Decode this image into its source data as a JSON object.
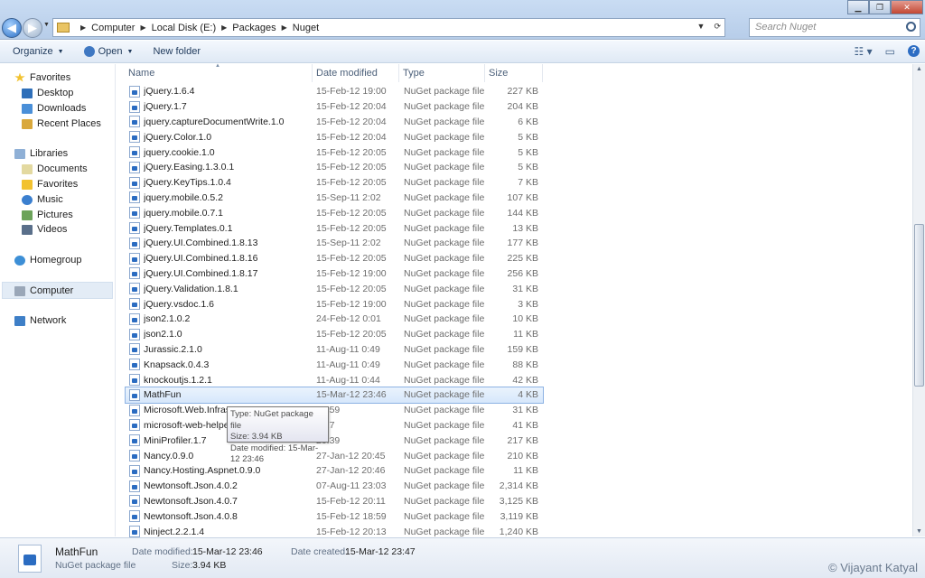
{
  "address": {
    "breadcrumbs": [
      "Computer",
      "Local Disk (E:)",
      "Packages",
      "Nuget"
    ],
    "search_placeholder": "Search Nuget"
  },
  "toolbar": {
    "organize": "Organize",
    "open": "Open",
    "new_folder": "New folder"
  },
  "nav": {
    "favorites": "Favorites",
    "desktop": "Desktop",
    "downloads": "Downloads",
    "recent_places": "Recent Places",
    "libraries": "Libraries",
    "documents": "Documents",
    "lib_favorites": "Favorites",
    "music": "Music",
    "pictures": "Pictures",
    "videos": "Videos",
    "homegroup": "Homegroup",
    "computer": "Computer",
    "network": "Network"
  },
  "columns": {
    "name": "Name",
    "date": "Date modified",
    "type": "Type",
    "size": "Size"
  },
  "files": [
    {
      "name": "jQuery.1.6.4",
      "date": "15-Feb-12 19:00",
      "type": "NuGet package file",
      "size": "227 KB"
    },
    {
      "name": "jQuery.1.7",
      "date": "15-Feb-12 20:04",
      "type": "NuGet package file",
      "size": "204 KB"
    },
    {
      "name": "jquery.captureDocumentWrite.1.0",
      "date": "15-Feb-12 20:04",
      "type": "NuGet package file",
      "size": "6 KB"
    },
    {
      "name": "jQuery.Color.1.0",
      "date": "15-Feb-12 20:04",
      "type": "NuGet package file",
      "size": "5 KB"
    },
    {
      "name": "jquery.cookie.1.0",
      "date": "15-Feb-12 20:05",
      "type": "NuGet package file",
      "size": "5 KB"
    },
    {
      "name": "jQuery.Easing.1.3.0.1",
      "date": "15-Feb-12 20:05",
      "type": "NuGet package file",
      "size": "5 KB"
    },
    {
      "name": "jQuery.KeyTips.1.0.4",
      "date": "15-Feb-12 20:05",
      "type": "NuGet package file",
      "size": "7 KB"
    },
    {
      "name": "jquery.mobile.0.5.2",
      "date": "15-Sep-11 2:02",
      "type": "NuGet package file",
      "size": "107 KB"
    },
    {
      "name": "jquery.mobile.0.7.1",
      "date": "15-Feb-12 20:05",
      "type": "NuGet package file",
      "size": "144 KB"
    },
    {
      "name": "jQuery.Templates.0.1",
      "date": "15-Feb-12 20:05",
      "type": "NuGet package file",
      "size": "13 KB"
    },
    {
      "name": "jQuery.UI.Combined.1.8.13",
      "date": "15-Sep-11 2:02",
      "type": "NuGet package file",
      "size": "177 KB"
    },
    {
      "name": "jQuery.UI.Combined.1.8.16",
      "date": "15-Feb-12 20:05",
      "type": "NuGet package file",
      "size": "225 KB"
    },
    {
      "name": "jQuery.UI.Combined.1.8.17",
      "date": "15-Feb-12 19:00",
      "type": "NuGet package file",
      "size": "256 KB"
    },
    {
      "name": "jQuery.Validation.1.8.1",
      "date": "15-Feb-12 20:05",
      "type": "NuGet package file",
      "size": "31 KB"
    },
    {
      "name": "jQuery.vsdoc.1.6",
      "date": "15-Feb-12 19:00",
      "type": "NuGet package file",
      "size": "3 KB"
    },
    {
      "name": "json2.1.0.2",
      "date": "24-Feb-12 0:01",
      "type": "NuGet package file",
      "size": "10 KB"
    },
    {
      "name": "json2.1.0",
      "date": "15-Feb-12 20:05",
      "type": "NuGet package file",
      "size": "11 KB"
    },
    {
      "name": "Jurassic.2.1.0",
      "date": "11-Aug-11 0:49",
      "type": "NuGet package file",
      "size": "159 KB"
    },
    {
      "name": "Knapsack.0.4.3",
      "date": "11-Aug-11 0:49",
      "type": "NuGet package file",
      "size": "88 KB"
    },
    {
      "name": "knockoutjs.1.2.1",
      "date": "11-Aug-11 0:44",
      "type": "NuGet package file",
      "size": "42 KB"
    },
    {
      "name": "MathFun",
      "date": "15-Mar-12 23:46",
      "type": "NuGet package file",
      "size": "4 KB"
    },
    {
      "name": "Microsoft.Web.Infrast",
      "date": "18:59",
      "type": "NuGet package file",
      "size": "31 KB"
    },
    {
      "name": "microsoft-web-helper",
      "date": "0:27",
      "type": "NuGet package file",
      "size": "41 KB"
    },
    {
      "name": "MiniProfiler.1.7",
      "date": "20:39",
      "type": "NuGet package file",
      "size": "217 KB"
    },
    {
      "name": "Nancy.0.9.0",
      "date": "27-Jan-12 20:45",
      "type": "NuGet package file",
      "size": "210 KB"
    },
    {
      "name": "Nancy.Hosting.Aspnet.0.9.0",
      "date": "27-Jan-12 20:46",
      "type": "NuGet package file",
      "size": "11 KB"
    },
    {
      "name": "Newtonsoft.Json.4.0.2",
      "date": "07-Aug-11 23:03",
      "type": "NuGet package file",
      "size": "2,314 KB"
    },
    {
      "name": "Newtonsoft.Json.4.0.7",
      "date": "15-Feb-12 20:11",
      "type": "NuGet package file",
      "size": "3,125 KB"
    },
    {
      "name": "Newtonsoft.Json.4.0.8",
      "date": "15-Feb-12 18:59",
      "type": "NuGet package file",
      "size": "3,119 KB"
    },
    {
      "name": "Ninject.2.2.1.4",
      "date": "15-Feb-12 20:13",
      "type": "NuGet package file",
      "size": "1,240 KB"
    }
  ],
  "tooltip": {
    "line1": "Type: NuGet package file",
    "line2": "Size: 3.94 KB",
    "line3": "Date modified: 15-Mar-12 23:46"
  },
  "details": {
    "name": "MathFun",
    "type": "NuGet package file",
    "date_modified_label": "Date modified:",
    "date_modified": "15-Mar-12 23:46",
    "date_created_label": "Date created:",
    "date_created": "15-Mar-12 23:47",
    "size_label": "Size:",
    "size": "3.94 KB"
  },
  "watermark": "© Vijayant Katyal",
  "selected_index": 20
}
